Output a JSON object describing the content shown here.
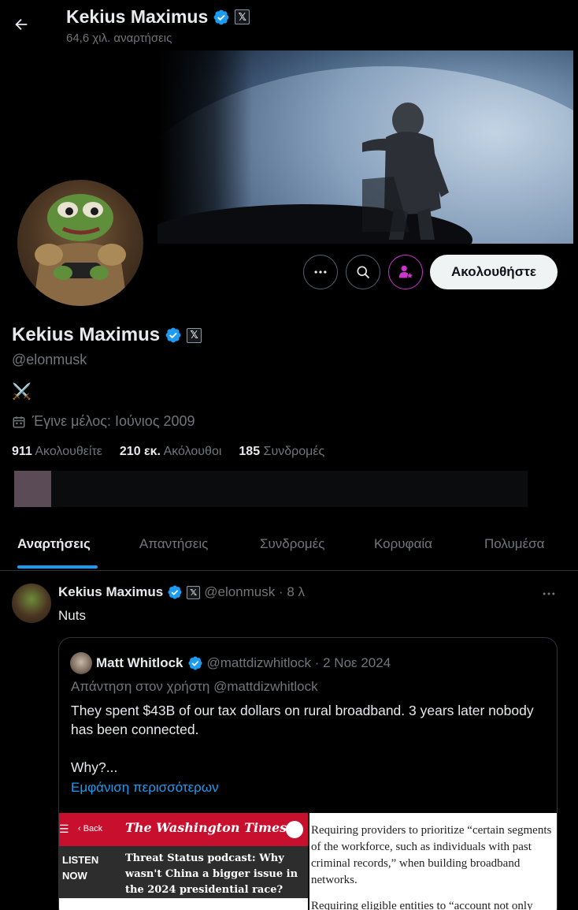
{
  "header": {
    "back_icon": "arrow-left-icon",
    "name": "Kekius Maximus",
    "posts_count": "64,6 χιλ. αναρτήσεις"
  },
  "profile": {
    "name": "Kekius Maximus",
    "handle": "@elonmusk",
    "bio": "⚔️",
    "joined": "Έγινε μέλος: Ιούνιος 2009",
    "stats": {
      "following_value": "911",
      "following_label": "Ακολουθείτε",
      "followers_value": "210 εκ.",
      "followers_label": "Ακόλουθοι",
      "subscriptions_value": "185",
      "subscriptions_label": "Συνδρομές"
    },
    "follow_label": "Ακολουθήστε"
  },
  "tabs": [
    {
      "label": "Αναρτήσεις",
      "active": true
    },
    {
      "label": "Απαντήσεις",
      "active": false
    },
    {
      "label": "Συνδρομές",
      "active": false
    },
    {
      "label": "Κορυφαία",
      "active": false
    },
    {
      "label": "Πολυμέσα",
      "active": false
    }
  ],
  "post": {
    "name": "Kekius Maximus",
    "handle_time": "@elonmusk · 8 λ",
    "text": "Nuts",
    "quote": {
      "name": "Matt Whitlock",
      "handle_time": "@mattdizwhitlock · 2 Νοε 2024",
      "reply_to": "Απάντηση στον χρήστη @mattdizwhitlock",
      "text": "They spent $43B of our tax dollars on rural broadband. 3 years later nobody has been connected.",
      "text2": "Why?...",
      "show_more": "Εμφάνιση περισσότερων",
      "image_left": {
        "back": "‹ Back",
        "logo": "The Washington Times",
        "listen": "LISTEN NOW",
        "headline": "Threat Status podcast: Why wasn't China a bigger issue in the 2024 presidential race?"
      },
      "image_right": {
        "p1": "Requiring providers to prioritize “certain segments of the workforce, such as individuals with past criminal records,” when building broadband networks.",
        "p2": "Requiring eligible entities to “account not only"
      }
    }
  },
  "colors": {
    "accent": "#1d9bf0",
    "muted": "#71767b",
    "text": "#e7e9ea",
    "border": "#2f3336",
    "subscribe_icon": "#c936cc"
  }
}
